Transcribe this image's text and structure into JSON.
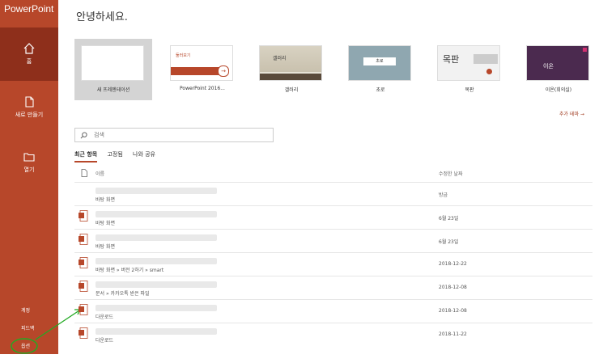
{
  "app": {
    "title": "PowerPoint",
    "greeting": "안녕하세요."
  },
  "sidebar": {
    "items": [
      {
        "label": "홈",
        "icon": "home-icon"
      },
      {
        "label": "새로 만들기",
        "icon": "new-file-icon"
      },
      {
        "label": "열기",
        "icon": "folder-icon"
      }
    ],
    "bottom": [
      "계정",
      "피드백",
      "옵션"
    ]
  },
  "templates": [
    {
      "label": "새 프레젠테이션"
    },
    {
      "label": "PowerPoint 2016...",
      "thumb_text": "둘러보기"
    },
    {
      "label": "갤러리",
      "thumb_text": "갤러리"
    },
    {
      "label": "초로",
      "thumb_text": "초로"
    },
    {
      "label": "목판",
      "thumb_text": "목판"
    },
    {
      "label": "이온(회의실)",
      "thumb_text": "이온"
    }
  ],
  "more_themes": "추가 테마 →",
  "search": {
    "placeholder": "검색"
  },
  "tabs": [
    "최근 항목",
    "고정됨",
    "나와 공유"
  ],
  "list": {
    "col_name": "이름",
    "col_date": "수정한 날짜",
    "rows": [
      {
        "path": "바탕 화면",
        "date": "방금"
      },
      {
        "path": "바탕 화면",
        "date": "6월 23일"
      },
      {
        "path": "바탕 화면",
        "date": "6월 23일"
      },
      {
        "path": "바탕 화면 » 버전 2하기 » smart",
        "date": "2018-12-22"
      },
      {
        "path": "문서 » 카카오톡 받은 파일",
        "date": "2018-12-08"
      },
      {
        "path": "다운로드",
        "date": "2018-12-08"
      },
      {
        "path": "다운로드",
        "date": "2018-11-22"
      }
    ]
  },
  "colors": {
    "accent": "#b7472a",
    "accent_dark": "#8e2f1b",
    "annotation": "#22aa22"
  }
}
